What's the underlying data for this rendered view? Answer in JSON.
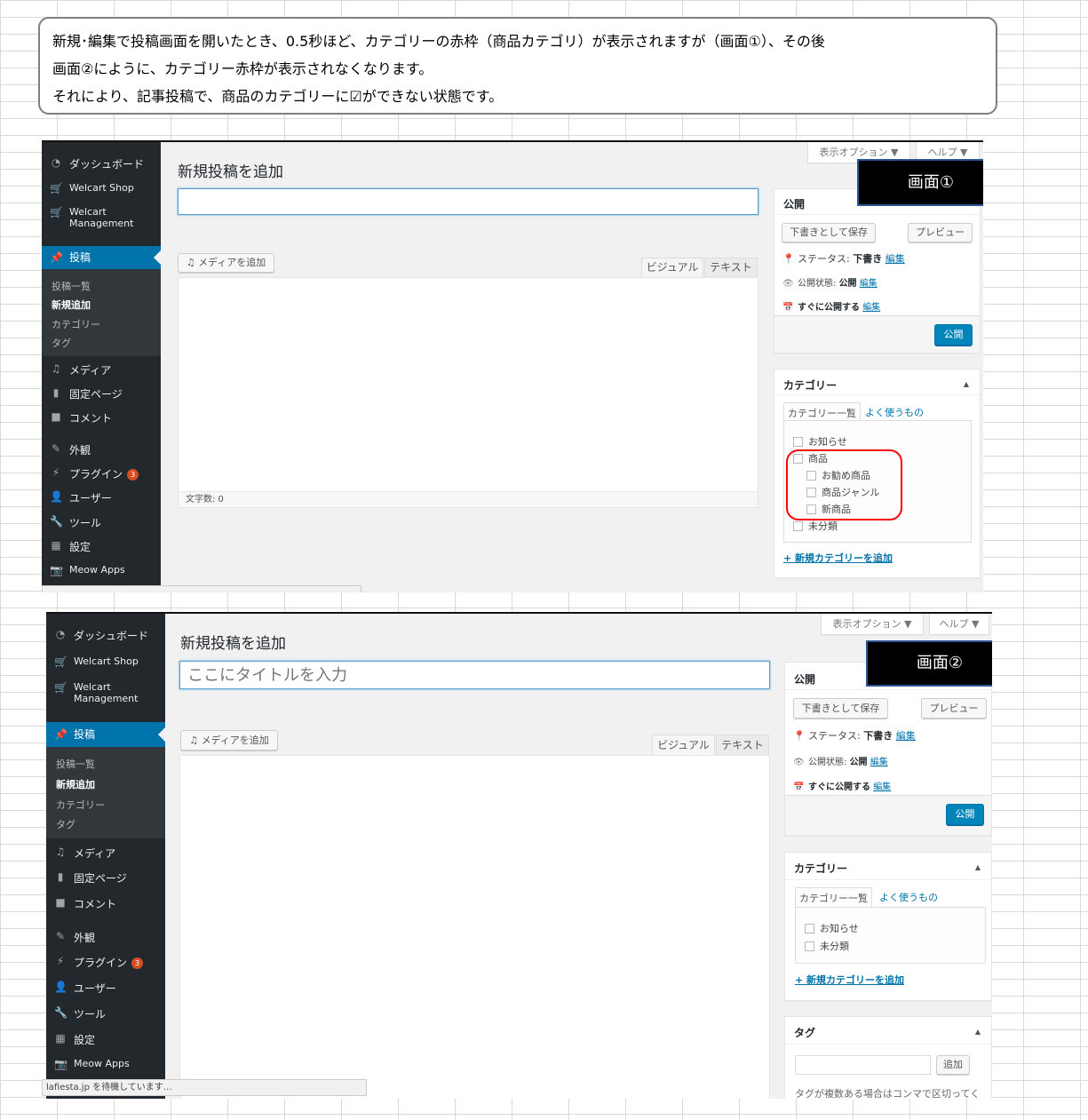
{
  "note": {
    "line1": "新規･編集で投稿画面を開いたとき、0.5秒ほど、カテゴリーの赤枠（商品カテゴリ）が表示されますが（画面①）、その後",
    "line2": "画面②にように、カテゴリー赤枠が表示されなくなります。",
    "line3": "それにより、記事投稿で、商品のカテゴリーに☑ができない状態です。"
  },
  "menu": {
    "dashboard": "ダッシュボード",
    "welcart_shop": "Welcart Shop",
    "welcart_mgmt_1": "Welcart",
    "welcart_mgmt_2": "Management",
    "posts": "投稿",
    "sub_all": "投稿一覧",
    "sub_new": "新規追加",
    "sub_category": "カテゴリー",
    "sub_tag": "タグ",
    "media": "メディア",
    "pages": "固定ページ",
    "comments": "コメント",
    "appearance": "外観",
    "plugins": "プラグイン",
    "plugins_badge": "3",
    "users": "ユーザー",
    "tools": "ツール",
    "settings": "設定",
    "meow": "Meow Apps"
  },
  "editor": {
    "page_title": "新規投稿を追加",
    "title_placeholder": "ここにタイトルを入力",
    "add_media": "メディアを追加",
    "tab_visual": "ビジュアル",
    "tab_text": "テキスト",
    "word_count": "文字数: 0",
    "screen_options": "表示オプション ▼",
    "help": "ヘルプ ▼"
  },
  "publish": {
    "title": "公開",
    "save_draft": "下書きとして保存",
    "preview": "プレビュー",
    "status_label": "ステータス:",
    "status_value": "下書き",
    "visibility_label": "公開状態:",
    "visibility_value": "公開",
    "schedule": "すぐに公開する",
    "edit": "編集",
    "publish_button": "公開"
  },
  "category": {
    "title": "カテゴリー",
    "tab_all": "カテゴリー一覧",
    "tab_popular": "よく使うもの",
    "items_screen1": [
      "お知らせ",
      "商品",
      "お勧め商品",
      "商品ジャンル",
      "新商品",
      "未分類"
    ],
    "items_screen2": [
      "お知らせ",
      "未分類"
    ],
    "add_new": "+ 新規カテゴリーを追加"
  },
  "tags": {
    "title": "タグ",
    "add_button": "追加",
    "help": "タグが複数ある場合はコンマで区切ってく"
  },
  "labels": {
    "screen1": "画面①",
    "screen2": "画面②"
  },
  "status_url": "lafiesta.jp を待機しています…",
  "icons": {
    "dashboard": "gauge-icon",
    "cart": "cart-icon",
    "pin": "pushpin-icon",
    "media": "media-icon",
    "pages": "pages-icon",
    "comments": "comment-icon",
    "appearance": "brush-icon",
    "plugins": "plug-icon",
    "users": "user-icon",
    "tools": "wrench-icon",
    "settings": "settings-icon",
    "meow": "camera-icon"
  },
  "colors": {
    "admin_bar": "#23282d",
    "active_menu": "#0073aa",
    "primary_button": "#0085ba",
    "highlight": "#ff0000"
  }
}
